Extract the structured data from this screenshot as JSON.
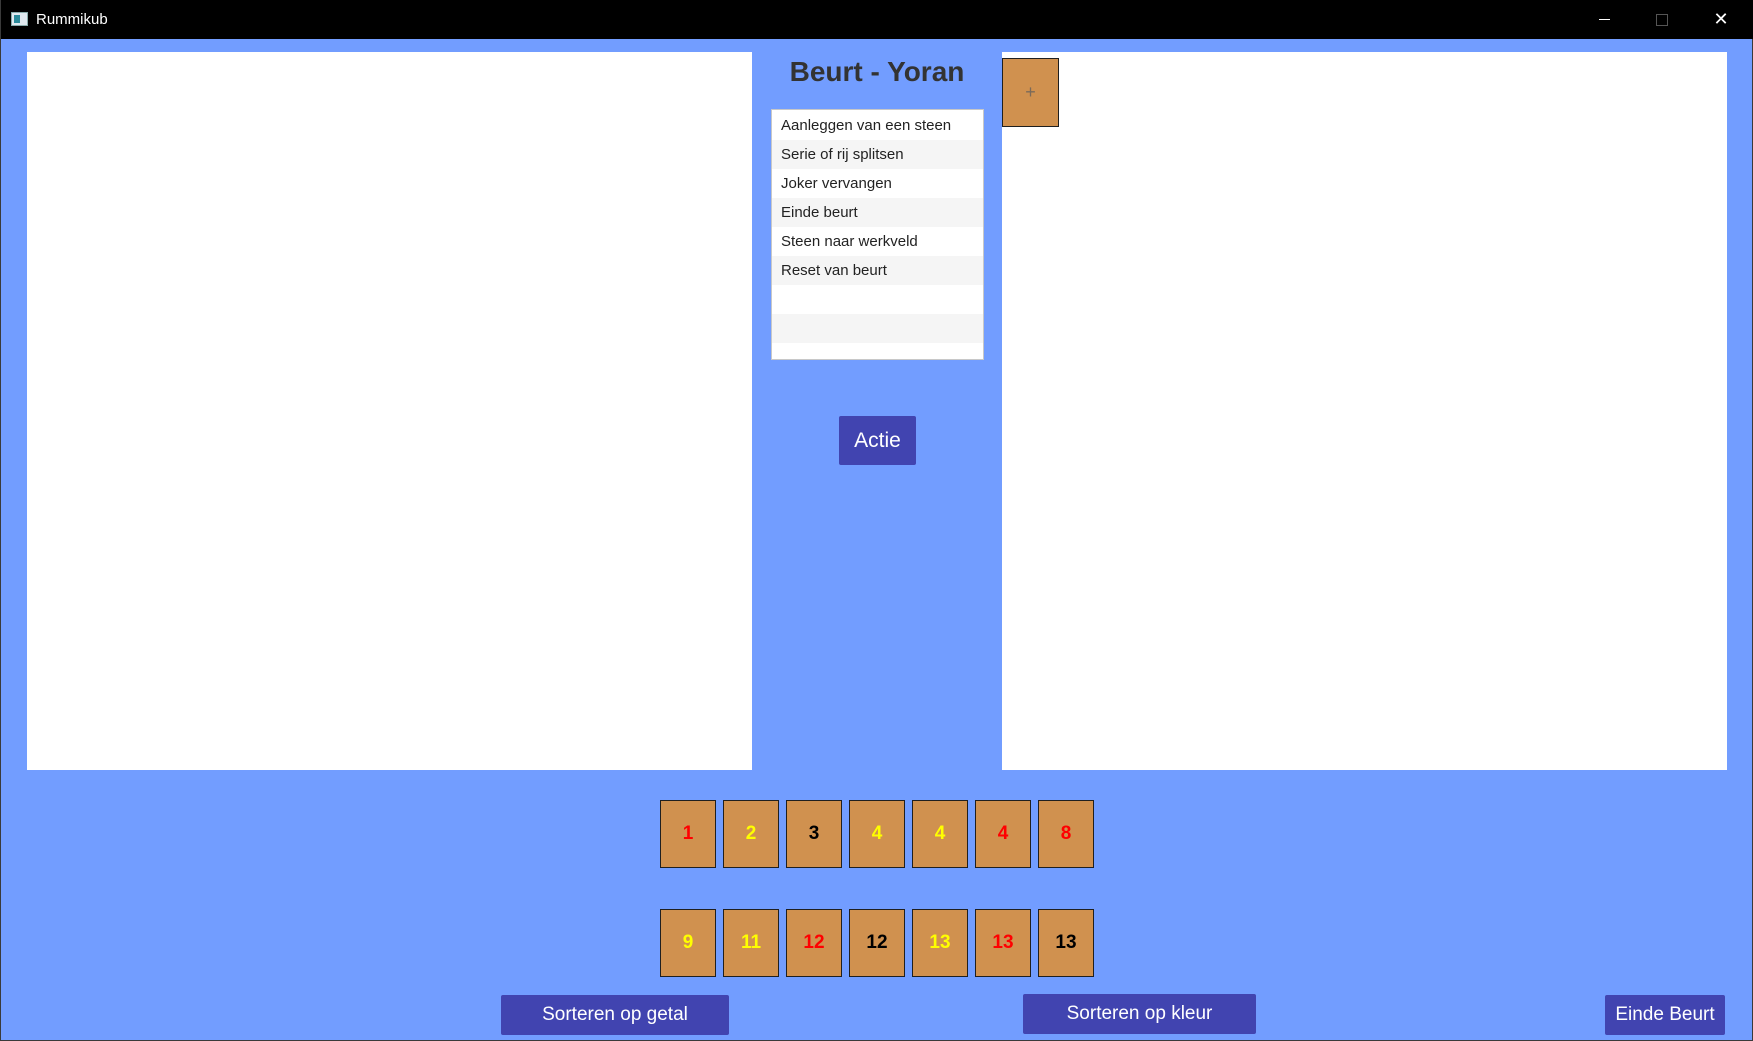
{
  "window": {
    "title": "Rummikub"
  },
  "colors": {
    "background": "#729DFF",
    "button": "#4144B0",
    "tile": "#D0914F",
    "red": "#FF0000",
    "yellow": "#FFFF00",
    "black": "#000000"
  },
  "turn": {
    "title": "Beurt - Yoran"
  },
  "actions": [
    "Aanleggen van een steen",
    "Serie of rij splitsen",
    "Joker vervangen",
    "Einde beurt",
    "Steen naar werkveld",
    "Reset van beurt"
  ],
  "buttons": {
    "actie": "Actie",
    "sort_by_number": "Sorteren op getal",
    "sort_by_color": "Sorteren op kleur",
    "end_turn": "Einde Beurt"
  },
  "workfield": {
    "add_tile": "+"
  },
  "rack": {
    "row1": [
      {
        "value": "1",
        "color": "red"
      },
      {
        "value": "2",
        "color": "yellow"
      },
      {
        "value": "3",
        "color": "black"
      },
      {
        "value": "4",
        "color": "yellow"
      },
      {
        "value": "4",
        "color": "yellow"
      },
      {
        "value": "4",
        "color": "red"
      },
      {
        "value": "8",
        "color": "red"
      }
    ],
    "row2": [
      {
        "value": "9",
        "color": "yellow"
      },
      {
        "value": "11",
        "color": "yellow"
      },
      {
        "value": "12",
        "color": "red"
      },
      {
        "value": "12",
        "color": "black"
      },
      {
        "value": "13",
        "color": "yellow"
      },
      {
        "value": "13",
        "color": "red"
      },
      {
        "value": "13",
        "color": "black"
      }
    ]
  }
}
